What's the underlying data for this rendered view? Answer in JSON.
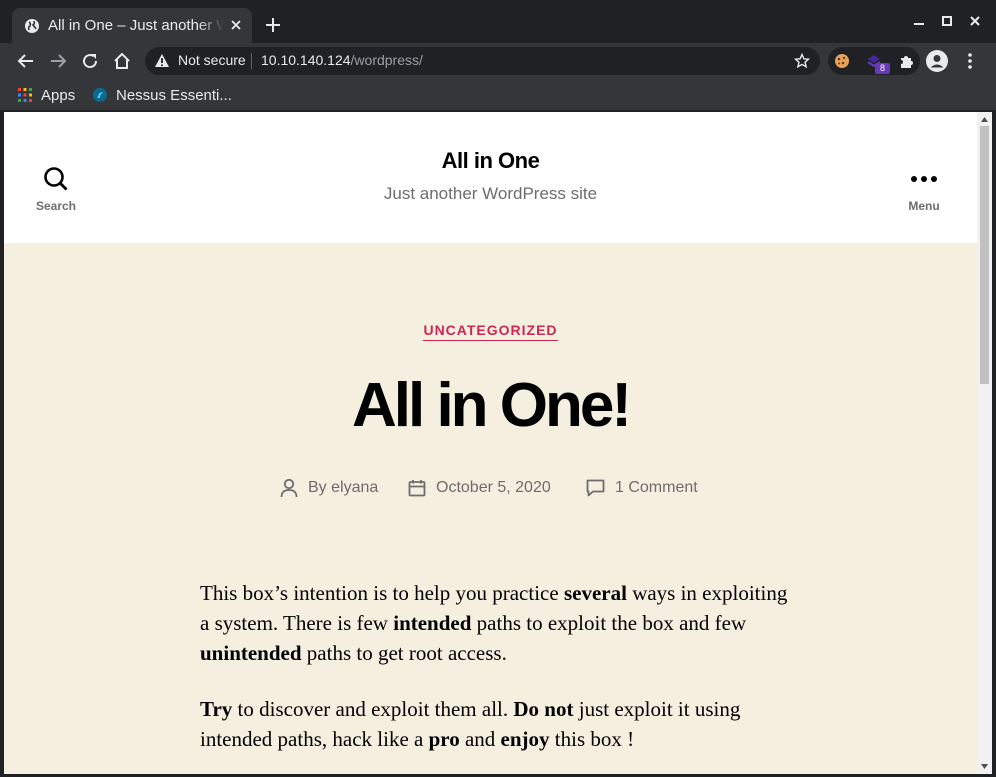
{
  "browser": {
    "tab_title": "All in One – Just another WordPress site",
    "security_label": "Not secure",
    "url_host": "10.10.140.124",
    "url_path": "/wordpress/",
    "extension_badge": "8",
    "bookmarks": [
      {
        "label": "Apps",
        "icon": "apps-grid-icon"
      },
      {
        "label": "Nessus Essenti...",
        "icon": "nessus-icon"
      }
    ]
  },
  "site": {
    "title": "All in One",
    "description": "Just another WordPress site",
    "search_label": "Search",
    "menu_label": "Menu"
  },
  "post": {
    "category": "UNCATEGORIZED",
    "title": "All in One!",
    "author": "By elyana",
    "date": "October 5, 2020",
    "comments": "1 Comment",
    "p1": [
      {
        "t": "This box’s intention is to help you practice ",
        "b": false
      },
      {
        "t": "several",
        "b": true
      },
      {
        "t": " ways in exploiting a system. There is few ",
        "b": false
      },
      {
        "t": "intended",
        "b": true
      },
      {
        "t": " paths to exploit the box and few ",
        "b": false
      },
      {
        "t": "unintended",
        "b": true
      },
      {
        "t": " paths to get root access.",
        "b": false
      }
    ],
    "p2": [
      {
        "t": "Try",
        "b": true
      },
      {
        "t": " to discover and exploit them all. ",
        "b": false
      },
      {
        "t": "Do not",
        "b": true
      },
      {
        "t": " just exploit it using intended paths, hack like a ",
        "b": false
      },
      {
        "t": "pro",
        "b": true
      },
      {
        "t": " and ",
        "b": false
      },
      {
        "t": "enjoy",
        "b": true
      },
      {
        "t": " this box !",
        "b": false
      }
    ]
  },
  "colors": {
    "accent": "#cd2653",
    "page_bg": "#f5efe0",
    "chrome_dark": "#202124",
    "chrome_toolbar": "#35363a"
  }
}
